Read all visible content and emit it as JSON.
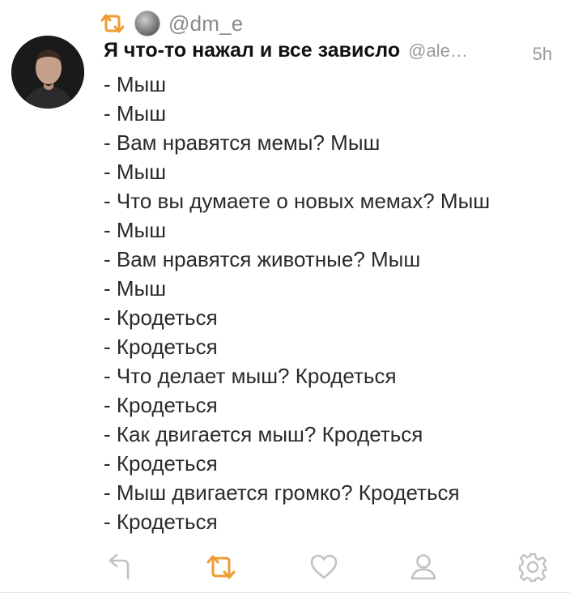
{
  "retweet": {
    "icon": "retweet-icon",
    "handle": "@dm_e"
  },
  "tweet": {
    "author_name": "Я что-то нажал и все зависло",
    "author_handle": "@ale…",
    "time": "5h",
    "lines": [
      "- Мыш",
      "- Мыш",
      "- Вам нравятся мемы? Мыш",
      "- Мыш",
      "- Что вы думаете о новых мемах? Мыш",
      "- Мыш",
      "- Вам нравятся животные? Мыш",
      "- Мыш",
      "- Кродеться",
      "- Кродеться",
      "- Что делает мыш? Кродеться",
      "- Кродеться",
      "- Как двигается мыш? Кродеться",
      "- Кродеться",
      "- Мыш двигается громко? Кродеться",
      "- Кродеться"
    ]
  },
  "actions": [
    {
      "icon": "reply-icon"
    },
    {
      "icon": "retweet-icon",
      "active": true
    },
    {
      "icon": "heart-icon"
    },
    {
      "icon": "person-icon"
    },
    {
      "icon": "gear-icon"
    }
  ],
  "colors": {
    "accent": "#f09a2f",
    "muted_icon": "#c2c2c2",
    "muted_text": "#9a9a9a",
    "text": "#2a2a2a"
  }
}
